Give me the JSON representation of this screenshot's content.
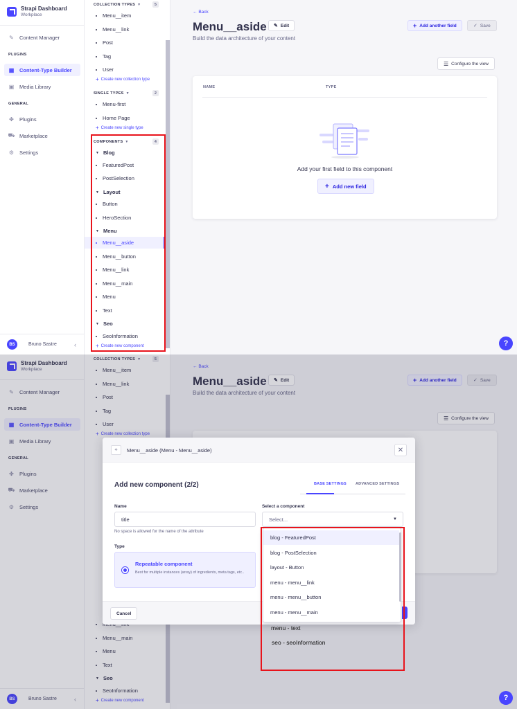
{
  "brand": {
    "title": "Strapi Dashboard",
    "subtitle": "Workplace"
  },
  "mainnav": {
    "content_manager": "Content Manager",
    "plugins_section": "PLUGINS",
    "ctb": "Content-Type Builder",
    "media": "Media Library",
    "general_section": "GENERAL",
    "plugins": "Plugins",
    "marketplace": "Marketplace",
    "settings": "Settings"
  },
  "user": {
    "initials": "BS",
    "name": "Bruno Sastre"
  },
  "subnav": {
    "collection_types": {
      "label": "COLLECTION TYPES",
      "count": "5",
      "items": [
        "Menu__item",
        "Menu__link",
        "Post",
        "Tag",
        "User"
      ],
      "create": "Create new collection type"
    },
    "single_types": {
      "label": "SINGLE TYPES",
      "count": "2",
      "items": [
        "Menu-first",
        "Home Page"
      ],
      "create": "Create new single type"
    },
    "components": {
      "label": "COMPONENTS",
      "count": "4",
      "categories": [
        {
          "name": "Blog",
          "items": [
            "FeaturedPost",
            "PostSelection"
          ]
        },
        {
          "name": "Layout",
          "items": [
            "Button",
            "HeroSection"
          ]
        },
        {
          "name": "Menu",
          "items": [
            "Menu__aside",
            "Menu__button",
            "Menu__link",
            "Menu__main",
            "Menu",
            "Text"
          ]
        },
        {
          "name": "Seo",
          "items": [
            "SeoInformation"
          ]
        }
      ],
      "create": "Create new component"
    }
  },
  "content": {
    "back": "Back",
    "title": "Menu__aside",
    "edit": "Edit",
    "subtitle": "Build the data architecture of your content",
    "add_another": "Add another field",
    "save": "Save",
    "configure": "Configure the view",
    "col_name": "NAME",
    "col_type": "TYPE",
    "empty_text": "Add your first field to this component",
    "add_new": "Add new field"
  },
  "help": "?",
  "modal": {
    "header": "Menu__aside (Menu - Menu__aside)",
    "title": "Add new component (2/2)",
    "tab_base": "BASE SETTINGS",
    "tab_advanced": "ADVANCED SETTINGS",
    "name_label": "Name",
    "name_value": "title",
    "name_hint": "No space is allowed for the name of the attribute",
    "select_label": "Select a component",
    "select_placeholder": "Select...",
    "type_label": "Type",
    "repeatable_title": "Repeatable component",
    "repeatable_desc": "Best for multiple instances (array) of ingredients, meta tags, etc..",
    "cancel": "Cancel",
    "options": [
      "blog - FeaturedPost",
      "blog - PostSelection",
      "layout - Button",
      "menu - menu__link",
      "menu - menu__button",
      "menu - menu__main"
    ],
    "overflow_options": [
      "menu - text",
      "seo - seoInformation"
    ]
  },
  "colors": {
    "accent": "#4945ff",
    "highlight": "#e8131b"
  }
}
